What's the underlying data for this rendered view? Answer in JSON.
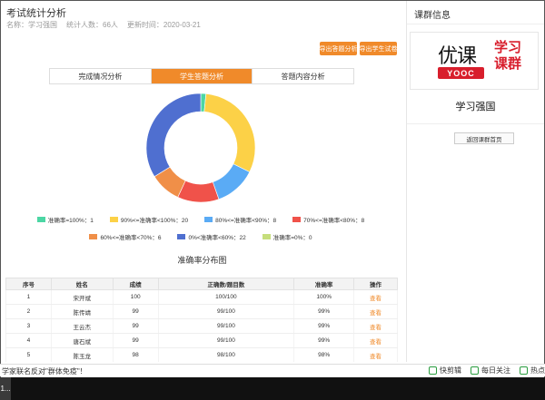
{
  "header": {
    "title": "考试统计分析",
    "name_label": "名称：学习强国",
    "count_label": "统计人数：66人",
    "update_label": "更新时间：2020-03-21"
  },
  "actions": {
    "export_answers": "导出答题分析",
    "export_papers": "导出学生试卷"
  },
  "tabs": [
    {
      "label": "完成情况分析",
      "active": false
    },
    {
      "label": "学生答题分析",
      "active": true
    },
    {
      "label": "答题内容分析",
      "active": false
    }
  ],
  "chart_data": {
    "type": "pie",
    "donut": true,
    "categories": [
      "准确率=100%",
      "90%<=准确率<100%",
      "80%<=准确率<90%",
      "70%<=准确率<80%",
      "60%<=准确率<70%",
      "0%<准确率<60%",
      "准确率=0%"
    ],
    "values": [
      1,
      20,
      8,
      8,
      6,
      22,
      0
    ],
    "colors": [
      "#4cd6a4",
      "#fcd147",
      "#5aabf5",
      "#f0524a",
      "#f08f48",
      "#4f6fd0",
      "#c6de7c"
    ],
    "title": "准确率分布图"
  },
  "legend_rows": [
    [
      "准确率=100%：1",
      "90%<=准确率<100%：20",
      "80%<=准确率<90%：8",
      "70%<=准确率<80%：8"
    ],
    [
      "60%<=准确率<70%：6",
      "0%<准确率<60%：22",
      "准确率=0%：0"
    ]
  ],
  "table": {
    "headers": [
      "序号",
      "姓名",
      "成绩",
      "正确数/题目数",
      "准确率",
      "操作"
    ],
    "rows": [
      [
        "1",
        "宋开斌",
        "100",
        "100/100",
        "100%",
        "查看"
      ],
      [
        "2",
        "陈传靖",
        "99",
        "99/100",
        "99%",
        "查看"
      ],
      [
        "3",
        "王云杰",
        "99",
        "99/100",
        "99%",
        "查看"
      ],
      [
        "4",
        "唐石斌",
        "99",
        "99/100",
        "99%",
        "查看"
      ],
      [
        "5",
        "陈玉龙",
        "98",
        "98/100",
        "98%",
        "查看"
      ]
    ]
  },
  "side": {
    "title": "课群信息",
    "logo_you": "优课",
    "logo_yooc": "YOOC",
    "logo_xuexi": "学习",
    "logo_kequn": "课群",
    "name": "学习强国",
    "back_label": "返回课群首页"
  },
  "bottom": {
    "ticker": "学家联名反对\"群体免疫\"！",
    "tool1": "快剪辑",
    "tool2": "每日关注",
    "tool3": "热点"
  },
  "taskbar": {
    "item": "1..."
  }
}
